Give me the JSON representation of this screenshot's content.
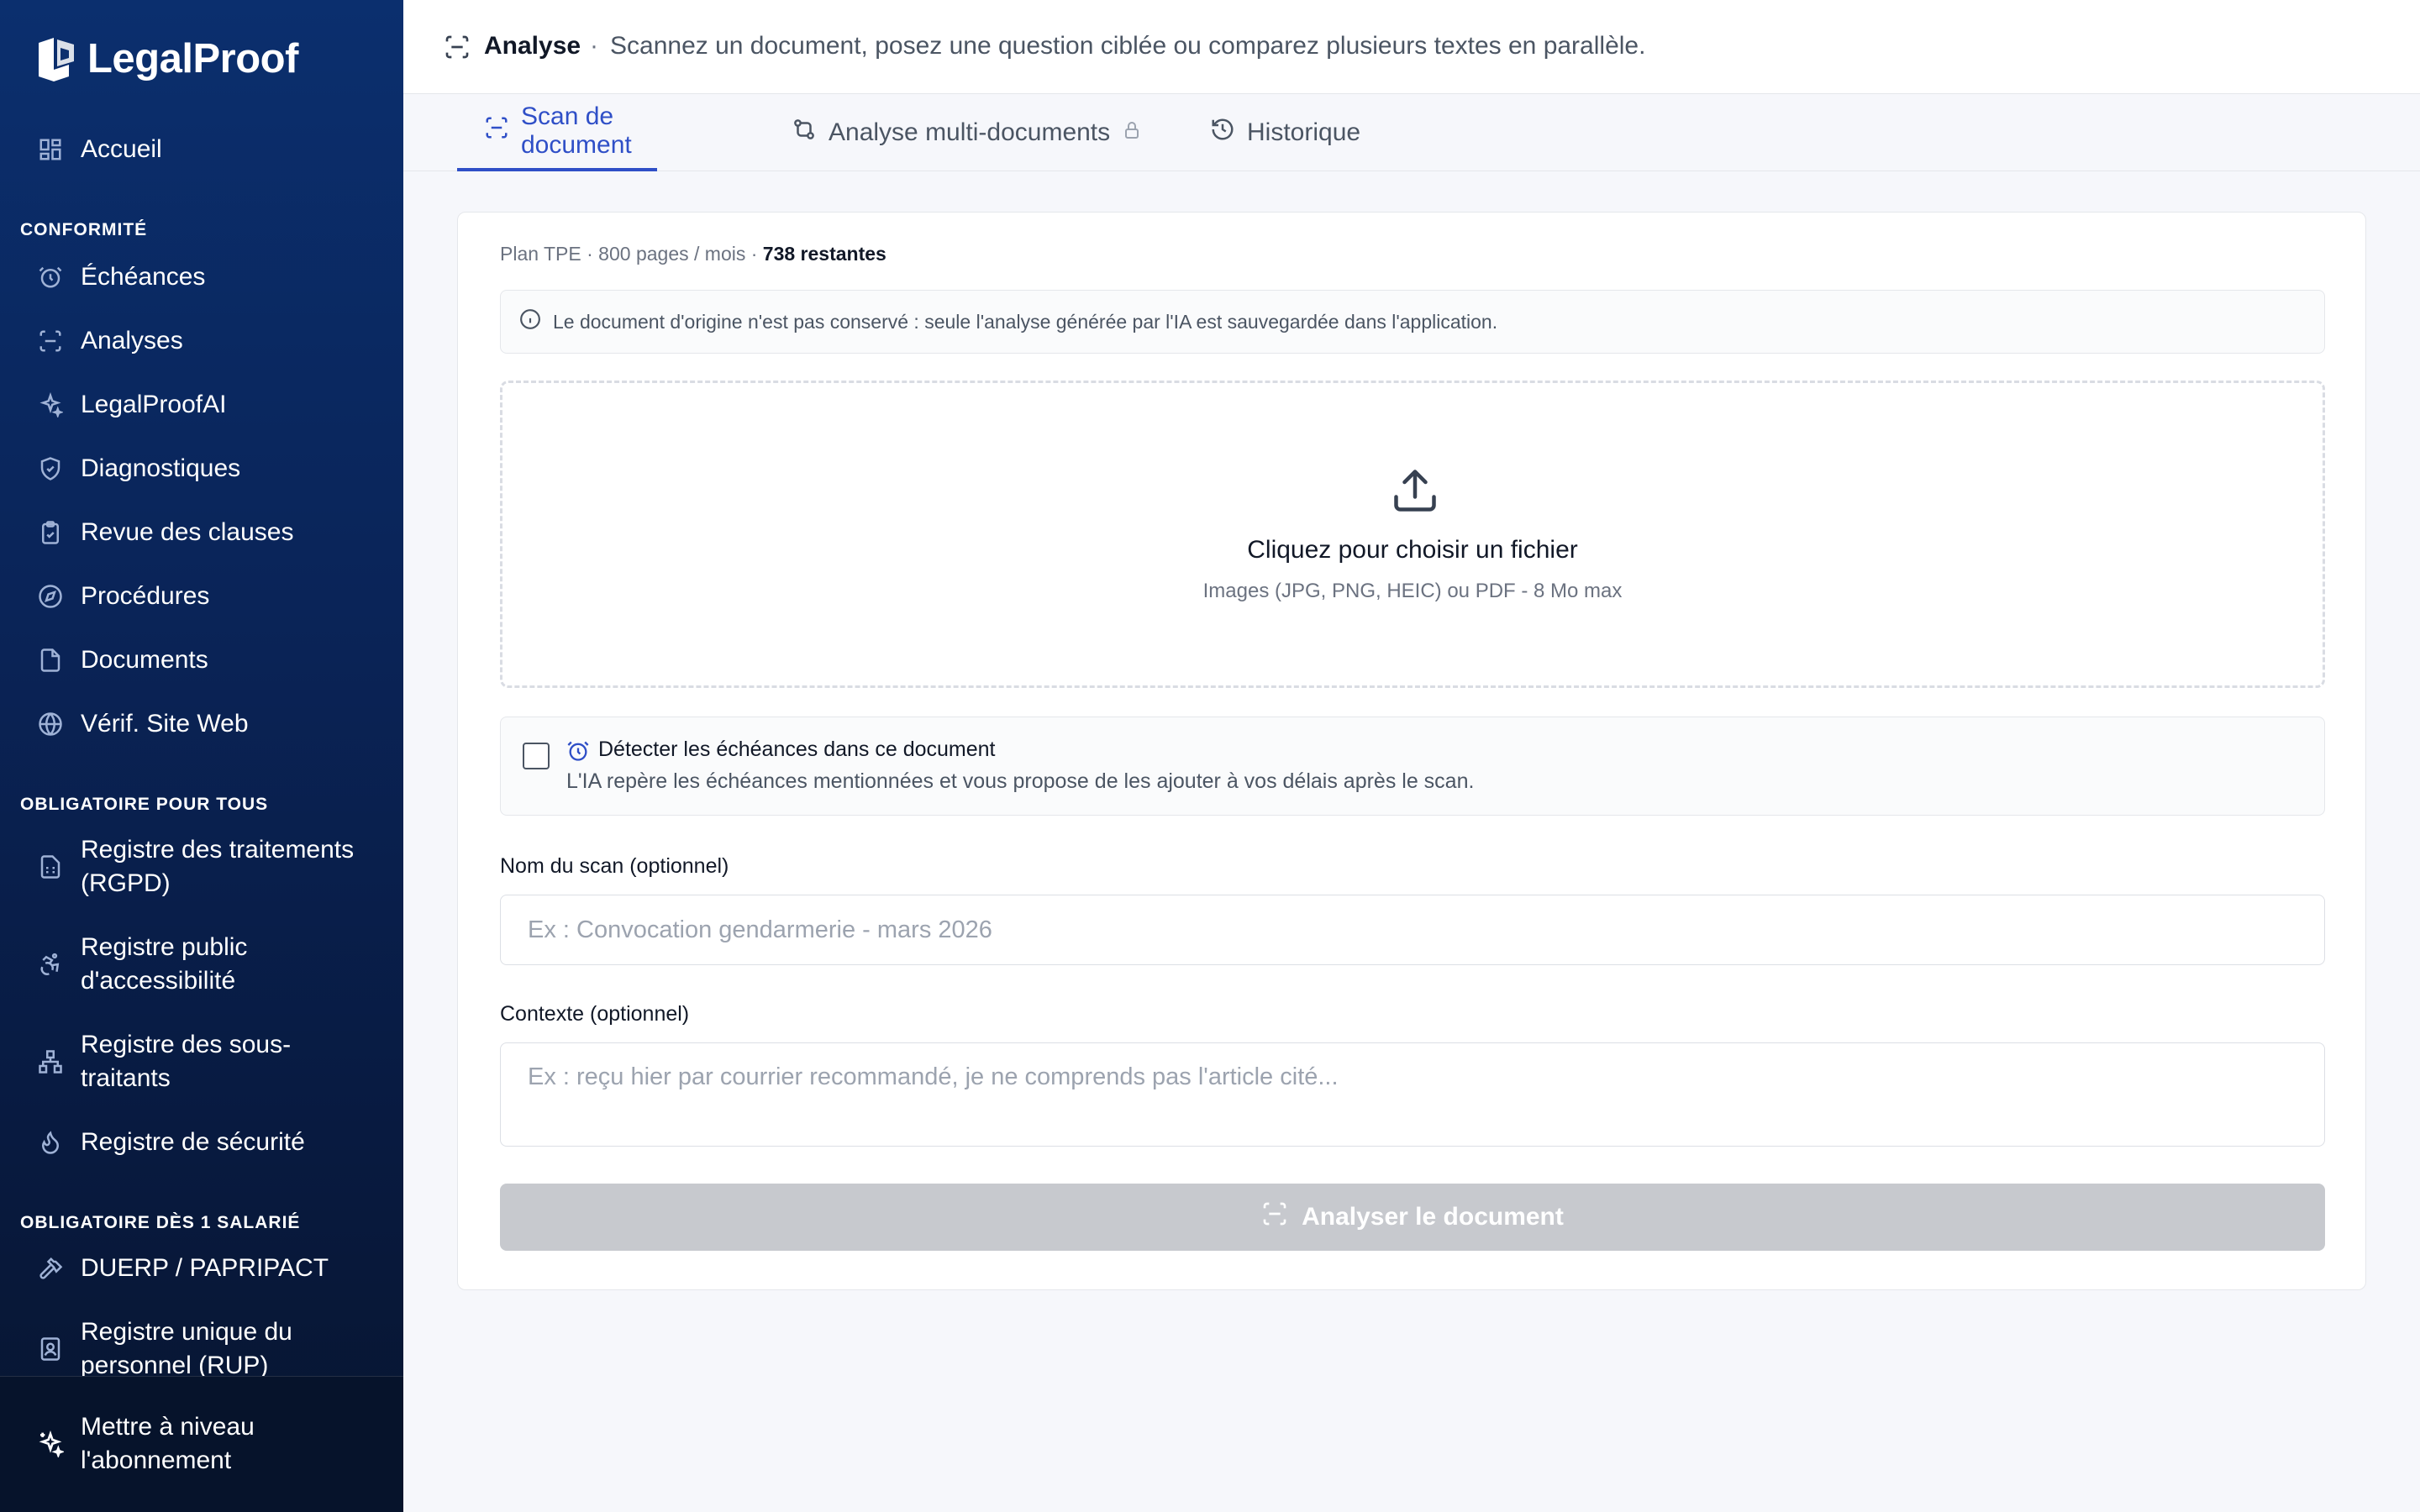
{
  "brand": {
    "name": "LegalProof"
  },
  "sidebar": {
    "home": {
      "label": "Accueil",
      "icon": "grid-icon"
    },
    "sections": [
      {
        "title": "CONFORMITÉ"
      },
      {
        "title": "OBLIGATOIRE POUR TOUS"
      },
      {
        "title": "OBLIGATOIRE DÈS 1 SALARIÉ"
      }
    ],
    "items": [
      {
        "label": "Échéances",
        "icon": "alarm-icon"
      },
      {
        "label": "Analyses",
        "icon": "scan-icon"
      },
      {
        "label": "LegalProofAI",
        "icon": "sparkles-icon"
      },
      {
        "label": "Diagnostiques",
        "icon": "shield-check-icon"
      },
      {
        "label": "Revue des clauses",
        "icon": "clipboard-check-icon"
      },
      {
        "label": "Procédures",
        "icon": "compass-icon"
      },
      {
        "label": "Documents",
        "icon": "file-icon"
      },
      {
        "label": "Vérif. Site Web",
        "icon": "globe-icon"
      },
      {
        "label_line1": "Registre des traitements",
        "label_line2": "(RGPD)",
        "icon": "file-spreadsheet-icon"
      },
      {
        "label_line1": "Registre public",
        "label_line2": "d'accessibilité",
        "icon": "accessibility-icon"
      },
      {
        "label_line1": "Registre des sous-",
        "label_line2": "traitants",
        "icon": "network-icon"
      },
      {
        "label": "Registre de sécurité",
        "icon": "flame-icon"
      },
      {
        "label": "DUERP / PAPRIPACT",
        "icon": "hammer-icon"
      },
      {
        "label_line1": "Registre unique du",
        "label_line2": "personnel (RUP)",
        "icon": "badge-icon"
      }
    ],
    "upgrade": {
      "label_line1": "Mettre à niveau",
      "label_line2": "l'abonnement",
      "icon": "sparkles-icon"
    }
  },
  "header": {
    "title": "Analyse",
    "separator": "·",
    "subtitle": "Scannez un document, posez une question ciblée ou comparez plusieurs textes en parallèle."
  },
  "tabs": [
    {
      "label": "Scan de document",
      "icon": "scan-icon",
      "active": true
    },
    {
      "label": "Analyse multi-documents",
      "icon": "git-compare-icon",
      "locked": true
    },
    {
      "label": "Historique",
      "icon": "history-icon"
    }
  ],
  "scan": {
    "quota_prefix": "Plan TPE · 800 pages / mois · ",
    "quota_remaining": "738 restantes",
    "notice": "Le document d'origine n'est pas conservé : seule l'analyse générée par l'IA est sauvegardée dans l'application.",
    "dropzone_title": "Cliquez pour choisir un fichier",
    "dropzone_hint": "Images (JPG, PNG, HEIC) ou PDF - 8 Mo max",
    "detect_title": "Détecter les échéances dans ce document",
    "detect_desc": "L'IA repère les échéances mentionnées et vous propose de les ajouter à vos délais après le scan.",
    "detect_checked": false,
    "name_label": "Nom du scan (optionnel)",
    "name_placeholder": "Ex : Convocation gendarmerie - mars 2026",
    "name_value": "",
    "context_label": "Contexte (optionnel)",
    "context_placeholder": "Ex : reçu hier par courrier recommandé, je ne comprends pas l'article cité...",
    "context_value": "",
    "analyze_label": "Analyser le document"
  },
  "colors": {
    "sidebar_top": "#0b2f6e",
    "sidebar_bottom": "#07152f",
    "accent": "#2f4fc7",
    "button_disabled": "#c7c9ce"
  }
}
